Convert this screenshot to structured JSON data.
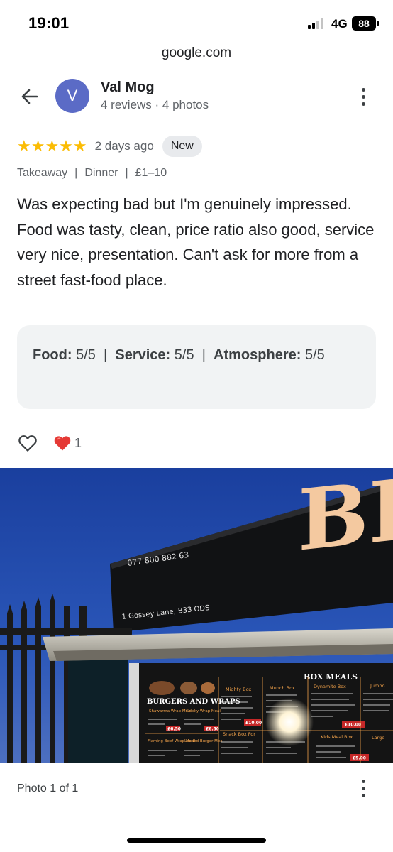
{
  "status_bar": {
    "time": "19:01",
    "network": "4G",
    "battery": "88"
  },
  "url_bar": {
    "domain": "google.com"
  },
  "reviewer": {
    "initial": "V",
    "name": "Val Mog",
    "meta": "4 reviews · 4 photos",
    "avatar_color": "#5b6bc6"
  },
  "review": {
    "stars": "★★★★★",
    "star_count": 5,
    "date": "2 days ago",
    "badge": "New",
    "tags": [
      "Takeaway",
      "Dinner",
      "£1–10"
    ],
    "tag_separator": "|",
    "text": "Was expecting bad but I'm genuinely impressed. Food was tasty, clean, price ratio also good, service very nice, presentation. Can't ask for more from a street fast-food place."
  },
  "ratings": {
    "food_label": "Food:",
    "food_value": "5/5",
    "service_label": "Service:",
    "service_value": "5/5",
    "atmosphere_label": "Atmosphere:",
    "atmosphere_value": "5/5",
    "separator": "|"
  },
  "reactions": {
    "like_count": "1",
    "heart_color": "#e53935"
  },
  "photo": {
    "phone": "077 800 882 63",
    "address": "1 Gossey Lane, B33 ODS",
    "sign_letters": "BI",
    "menu_title_left": "BURGERS AND WRAPS",
    "menu_title_right": "BOX MEALS",
    "menu_headings": [
      "Mighty Box",
      "Munch Box",
      "Dynamite Box",
      "Jumbo",
      "Snack Box For",
      "Kids Meal Box",
      "Large"
    ],
    "menu_subtitles": [
      "Shawarma Wrap Meal",
      "Chicky Wrap Meal",
      "Flaming Beef Wrap Meal",
      "Loaded Burger Meal"
    ],
    "prices": [
      "£6.50",
      "£6.50",
      "£10.00",
      "£10.00",
      "£5.00"
    ]
  },
  "footer": {
    "photo_counter": "Photo 1 of 1"
  },
  "colors": {
    "star": "#fbbc04",
    "badge_bg": "#e8eaed",
    "ratings_bg": "#f1f3f4"
  }
}
